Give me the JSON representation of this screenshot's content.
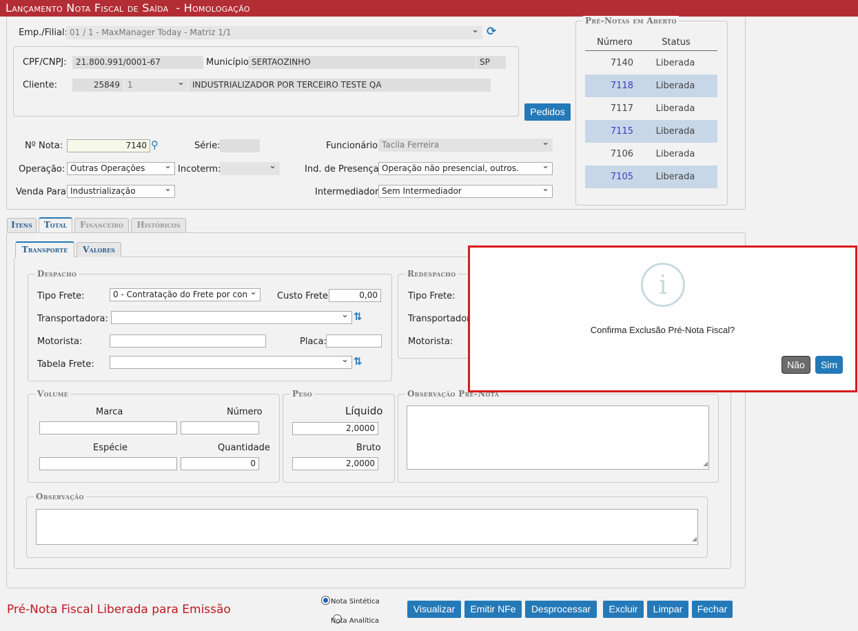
{
  "title": "Lançamento Nota Fiscal de Saída",
  "env": "- Homologação",
  "header": {
    "emp_label": "Emp./Filial:",
    "emp_value": "01 / 1 - MaxManager Today - Matriz 1/1",
    "cpf_label": "CPF/CNPJ:",
    "cpf_value": "21.800.991/0001-67",
    "municipio_label": "Município:",
    "municipio_value": "SERTAOZINHO",
    "uf_value": "SP",
    "cliente_label": "Cliente:",
    "cliente_code": "25849",
    "cliente_seq": "1",
    "cliente_name": "INDUSTRIALIZADOR POR TERCEIRO TESTE QA",
    "pedidos_button": "Pedidos"
  },
  "nota": {
    "num_label": "Nº Nota:",
    "num_value": "7140",
    "serie_label": "Série:",
    "serie_value": "",
    "func_label": "Funcionário:",
    "func_value": "Tacila Ferreira",
    "op_label": "Operação:",
    "op_value": "Outras Operações",
    "incoterm_label": "Incoterm:",
    "incoterm_value": "",
    "presenca_label": "Ind. de Presença:",
    "presenca_value": "Operação não presencial, outros.",
    "venda_label": "Venda Para:",
    "venda_value": "Industrialização",
    "interm_label": "Intermediador:",
    "interm_value": "Sem Intermediador"
  },
  "pre_notas": {
    "legend": "Pré-Notas em Aberto",
    "col_numero": "Número",
    "col_status": "Status",
    "rows": [
      {
        "numero": "7140",
        "status": "Liberada"
      },
      {
        "numero": "7118",
        "status": "Liberada"
      },
      {
        "numero": "7117",
        "status": "Liberada"
      },
      {
        "numero": "7115",
        "status": "Liberada"
      },
      {
        "numero": "7106",
        "status": "Liberada"
      },
      {
        "numero": "7105",
        "status": "Liberada"
      }
    ]
  },
  "tabs": [
    "Itens",
    "Total",
    "Financeiro",
    "Históricos"
  ],
  "subtabs": [
    "Transporte",
    "Valores"
  ],
  "despacho": {
    "legend": "Despacho",
    "tipo_frete_label": "Tipo Frete:",
    "tipo_frete_value": "0 - Contratação do Frete por con",
    "custo_label": "Custo Frete:",
    "custo_value": "0,00",
    "transp_label": "Transportadora:",
    "transp_value": "",
    "motorista_label": "Motorista:",
    "motorista_value": "",
    "placa_label": "Placa:",
    "placa_value": "",
    "tabela_label": "Tabela Frete:",
    "tabela_value": ""
  },
  "redespacho": {
    "legend": "Redespacho",
    "tipo_frete_label": "Tipo Frete:",
    "transp_label": "Transportadora:",
    "motorista_label": "Motorista:"
  },
  "volume": {
    "legend": "Volume",
    "marca_label": "Marca",
    "marca_value": "",
    "numero_label": "Número",
    "numero_value": "",
    "especie_label": "Espécie",
    "especie_value": "",
    "qtd_label": "Quantidade",
    "qtd_value": "0"
  },
  "peso": {
    "legend": "Peso",
    "liquido_label": "Líquido",
    "liquido_value": "2,0000",
    "bruto_label": "Bruto",
    "bruto_value": "2,0000"
  },
  "obs_prenota": {
    "legend": "Observação Pré-Nota",
    "value": ""
  },
  "observacao": {
    "legend": "Observação",
    "value": ""
  },
  "status_message": "Pré-Nota Fiscal Liberada para Emissão",
  "radio": {
    "sintetica": "Nota Sintética",
    "analitica": "Nota Analítica"
  },
  "actions": [
    "Visualizar",
    "Emitir NFe",
    "Desprocessar",
    "Excluir",
    "Limpar",
    "Fechar"
  ],
  "dialog": {
    "message": "Confirma Exclusão Pré-Nota Fiscal?",
    "no": "Não",
    "yes": "Sim",
    "icon": "info-icon"
  },
  "colors": {
    "title_bar": "#b32d35",
    "primary_button": "#2479b8",
    "status_text": "#c0181f",
    "dialog_border": "#d9191d",
    "row_highlight": "#c7d7e8"
  }
}
